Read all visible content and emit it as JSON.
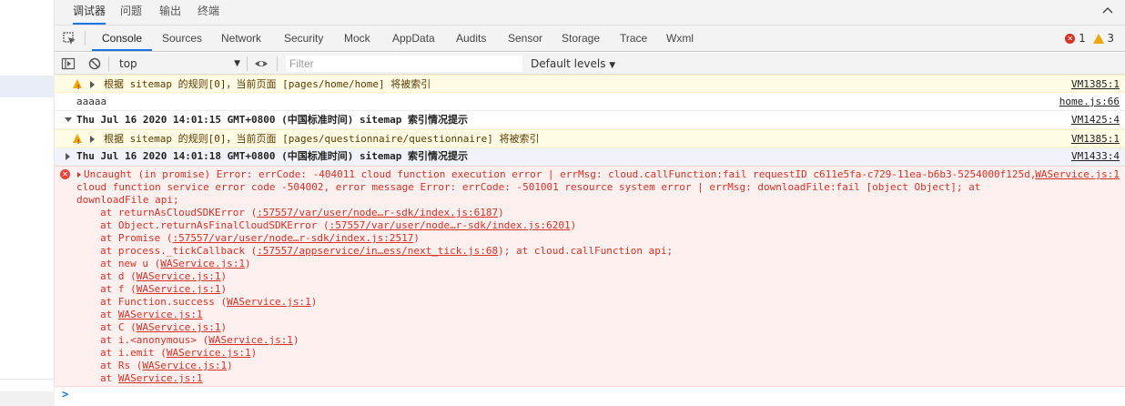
{
  "panel_tabs": [
    "调试器",
    "问题",
    "输出",
    "终端"
  ],
  "devtools_tabs": [
    "Console",
    "Sources",
    "Network",
    "Security",
    "Mock",
    "AppData",
    "Audits",
    "Sensor",
    "Storage",
    "Trace",
    "Wxml"
  ],
  "counts": {
    "errors": "1",
    "warnings": "3"
  },
  "toolbar": {
    "context": "top",
    "filter_placeholder": "Filter",
    "levels": "Default levels"
  },
  "messages": {
    "warn1": {
      "text": "根据 sitemap 的规则[0]，当前页面 [pages/home/home] 将被索引",
      "source": "VM1385:1"
    },
    "log1": {
      "text": "aaaaa",
      "source": "home.js:66"
    },
    "group1": {
      "text": "Thu Jul 16 2020 14:01:15 GMT+0800 (中国标准时间) sitemap 索引情况提示",
      "source": "VM1425:4"
    },
    "warn2": {
      "text": "根据 sitemap 的规则[0]，当前页面 [pages/questionnaire/questionnaire] 将被索引",
      "source": "VM1385:1"
    },
    "group2": {
      "text": "Thu Jul 16 2020 14:01:18 GMT+0800 (中国标准时间) sitemap 索引情况提示",
      "source": "VM1433:4"
    }
  },
  "error": {
    "source": "WAService.js:1",
    "message": "Uncaught (in promise) Error: errCode: -404011 cloud function execution error | errMsg: cloud.callFunction:fail requestID c611e5fa-c729-11ea-b6b3-5254000f125d, cloud function service error code -504002, error message Error: errCode: -501001 resource system error | errMsg: downloadFile:fail [object Object]; at downloadFile api;",
    "stack": [
      {
        "pre": "at returnAsCloudSDKError (",
        "link": ":57557/var/user/node…r-sdk/index.js:6187",
        "post": ")"
      },
      {
        "pre": "at Object.returnAsFinalCloudSDKError (",
        "link": ":57557/var/user/node…r-sdk/index.js:6201",
        "post": ")"
      },
      {
        "pre": "at Promise (",
        "link": ":57557/var/user/node…r-sdk/index.js:2517",
        "post": ")"
      },
      {
        "pre": "at process._tickCallback (",
        "link": ":57557/appservice/in…ess/next_tick.js:68",
        "post": "); at cloud.callFunction api;"
      },
      {
        "pre": "at new u (",
        "link": "WAService.js:1",
        "post": ")"
      },
      {
        "pre": "at d (",
        "link": "WAService.js:1",
        "post": ")"
      },
      {
        "pre": "at f (",
        "link": "WAService.js:1",
        "post": ")"
      },
      {
        "pre": "at Function.success (",
        "link": "WAService.js:1",
        "post": ")"
      },
      {
        "pre": "at ",
        "link": "WAService.js:1",
        "post": ""
      },
      {
        "pre": "at C (",
        "link": "WAService.js:1",
        "post": ")"
      },
      {
        "pre": "at i.<anonymous> (",
        "link": "WAService.js:1",
        "post": ")"
      },
      {
        "pre": "at i.emit (",
        "link": "WAService.js:1",
        "post": ")"
      },
      {
        "pre": "at Rs (",
        "link": "WAService.js:1",
        "post": ")"
      },
      {
        "pre": "at ",
        "link": "WAService.js:1",
        "post": ""
      }
    ]
  },
  "prompt": ">",
  "icons": [
    "collapse-icon",
    "inspect-icon",
    "error-icon",
    "warning-icon",
    "sidebar-toggle-icon",
    "clear-icon",
    "eye-icon"
  ]
}
